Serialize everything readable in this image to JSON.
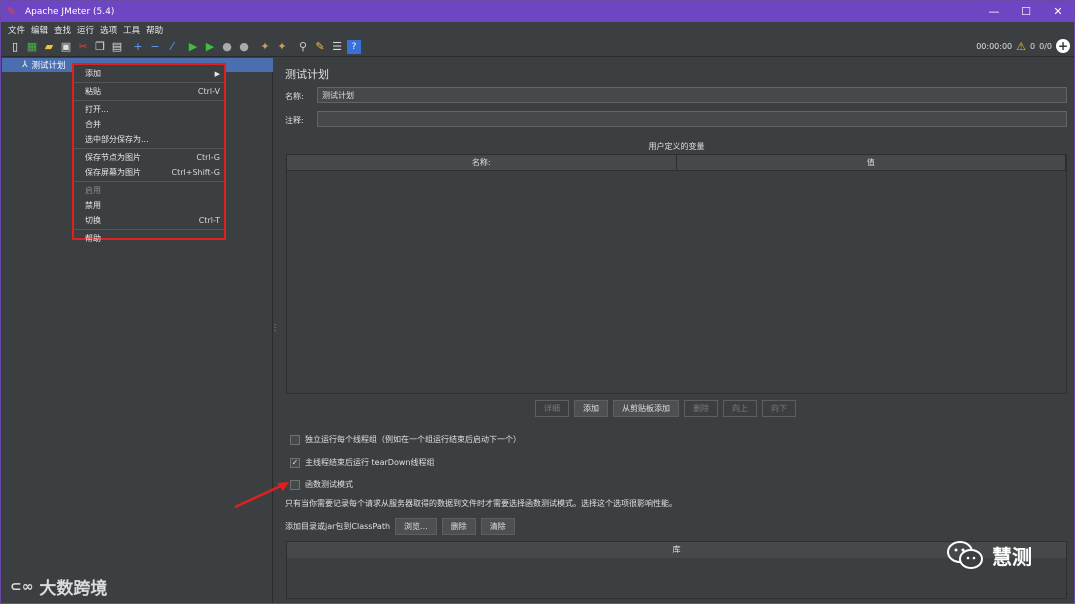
{
  "window": {
    "title": "Apache JMeter (5.4)",
    "controls": [
      "minimize",
      "maximize",
      "close"
    ]
  },
  "menubar": {
    "items": [
      "文件",
      "编辑",
      "查找",
      "运行",
      "选项",
      "工具",
      "帮助"
    ]
  },
  "toolbar": {
    "icons": [
      "new-icon",
      "templates-icon",
      "open-icon",
      "save-icon",
      "cut-icon",
      "copy-icon",
      "paste-icon",
      "expand-icon",
      "collapse-icon",
      "toggle-icon",
      "start-icon",
      "start-no-pause-icon",
      "stop-icon",
      "shutdown-icon",
      "clear-icon",
      "clear-all-icon",
      "search-icon",
      "reset-search-icon",
      "function-helper-icon",
      "help-icon"
    ],
    "timer": "00:00:00",
    "warning_count": "0",
    "threads": "0/0"
  },
  "tree": {
    "selected_node": "测试计划"
  },
  "context_menu": {
    "items": [
      {
        "label": "添加",
        "shortcut": "",
        "submenu": true
      },
      {
        "label": "粘贴",
        "shortcut": "Ctrl-V"
      },
      {
        "label": "打开...",
        "shortcut": ""
      },
      {
        "label": "合并",
        "shortcut": ""
      },
      {
        "label": "选中部分保存为...",
        "shortcut": ""
      },
      {
        "label": "保存节点为图片",
        "shortcut": "Ctrl-G"
      },
      {
        "label": "保存屏幕为图片",
        "shortcut": "Ctrl+Shift-G"
      },
      {
        "label": "启用",
        "shortcut": "",
        "disabled": true
      },
      {
        "label": "禁用",
        "shortcut": ""
      },
      {
        "label": "切换",
        "shortcut": "Ctrl-T"
      },
      {
        "label": "帮助",
        "shortcut": ""
      }
    ]
  },
  "test_plan": {
    "heading": "测试计划",
    "name_label": "名称:",
    "name_value": "测试计划",
    "comment_label": "注释:",
    "comment_value": "",
    "variables_caption": "用户定义的变量",
    "columns": [
      "名称:",
      "值"
    ],
    "buttons": [
      {
        "label": "详细",
        "disabled": true
      },
      {
        "label": "添加",
        "disabled": false
      },
      {
        "label": "从剪贴板添加",
        "disabled": false
      },
      {
        "label": "删除",
        "disabled": true
      },
      {
        "label": "向上",
        "disabled": true
      },
      {
        "label": "向下",
        "disabled": true
      }
    ],
    "checkboxes": [
      {
        "label": "独立运行每个线程组（例如在一个组运行结束后启动下一个）",
        "checked": false
      },
      {
        "label": "主线程结束后运行 tearDown线程组",
        "checked": true
      },
      {
        "label": "函数测试模式",
        "checked": false
      }
    ],
    "note": "只有当你需要记录每个请求从服务器取得的数据到文件时才需要选择函数测试模式。选择这个选项很影响性能。",
    "classpath_label": "添加目录或jar包到ClassPath",
    "classpath_buttons": [
      "浏览...",
      "删除",
      "清除"
    ],
    "library_header": "库"
  },
  "watermarks": {
    "left": "大数跨境",
    "right": "慧测"
  },
  "colors": {
    "titlebar": "#6e45c2",
    "panel": "#3c3f41",
    "selection": "#4b6eaf",
    "highlight_box": "#e02020"
  }
}
